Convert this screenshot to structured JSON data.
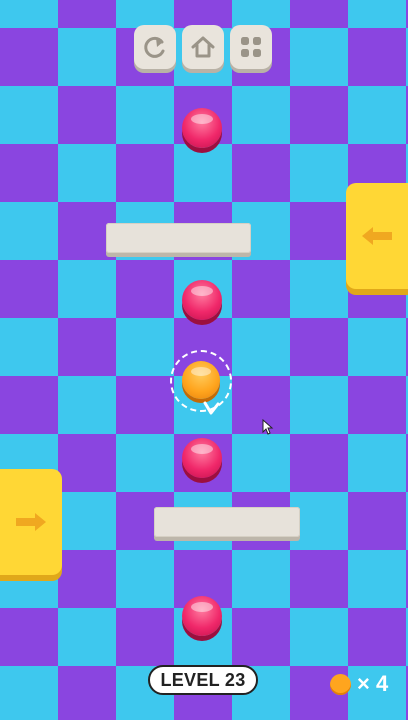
{
  "game": {
    "level_label": "LEVEL 23",
    "coin_count_label": "× 4"
  },
  "toolbar": {
    "buttons": [
      {
        "name": "restart-button",
        "icon": "restart-icon"
      },
      {
        "name": "home-button",
        "icon": "home-icon"
      },
      {
        "name": "menu-button",
        "icon": "grid-menu-icon"
      }
    ]
  },
  "side_pads": [
    {
      "name": "right-push-pad",
      "icon": "arrow-left-icon"
    },
    {
      "name": "left-push-pad",
      "icon": "arrow-right-icon"
    }
  ],
  "colors": {
    "checker_cyan": "#3ec8ee",
    "checker_purple": "#8a45e0",
    "target_pink": "#f0286a",
    "player_orange": "#ffa51e",
    "pad_yellow": "#ffd735",
    "bar_gray": "#e7e2da"
  }
}
